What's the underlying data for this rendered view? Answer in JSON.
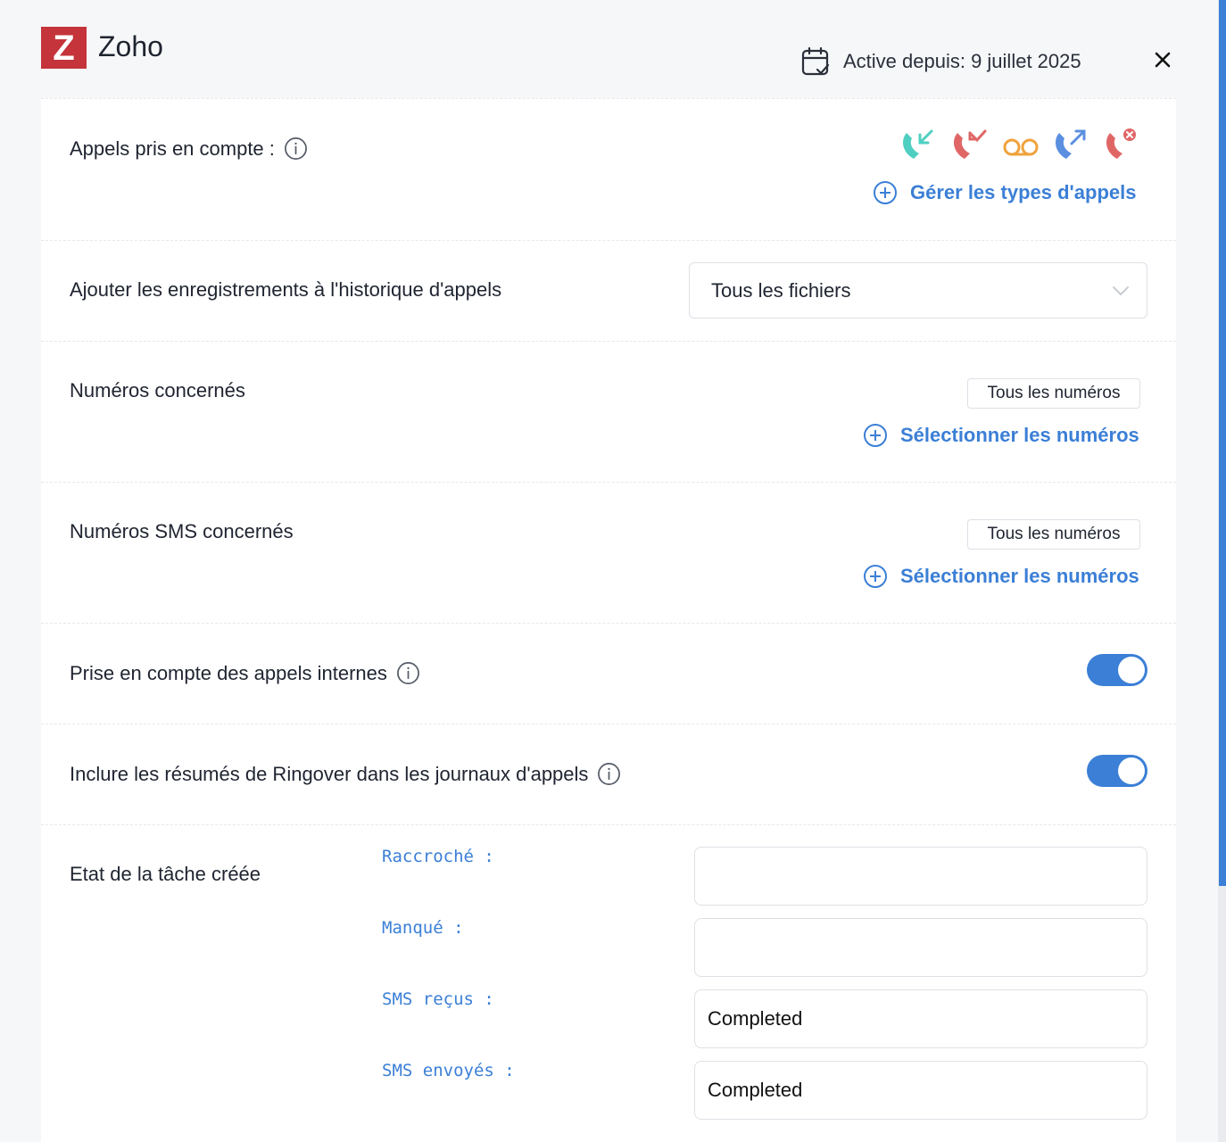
{
  "header": {
    "logo_letter": "Z",
    "app_name": "Zoho",
    "active_since": "Active depuis: 9 juillet 2025"
  },
  "colors": {
    "accent": "#3b7fd6",
    "brand": "#c4343a",
    "incoming": "#4fcfc1",
    "missed": "#e06666",
    "voicemail": "#f0a23c",
    "outgoing": "#5b8fe0",
    "rejected": "#e06666"
  },
  "sections": {
    "calls": {
      "label": "Appels pris en compte :",
      "call_type_icons": [
        "incoming-call-icon",
        "missed-call-icon",
        "voicemail-icon",
        "outgoing-call-icon",
        "rejected-call-icon"
      ],
      "manage_link": "Gérer les types d'appels"
    },
    "recordings": {
      "label": "Ajouter les enregistrements à l'historique d'appels",
      "selected": "Tous les fichiers"
    },
    "numbers": {
      "label": "Numéros concernés",
      "chip": "Tous les numéros",
      "select_link": "Sélectionner les numéros"
    },
    "sms_numbers": {
      "label": "Numéros SMS concernés",
      "chip": "Tous les numéros",
      "select_link": "Sélectionner les numéros"
    },
    "internal_calls": {
      "label": "Prise en compte des appels internes",
      "enabled": true
    },
    "summaries": {
      "label": "Inclure les résumés de Ringover dans les journaux d'appels",
      "enabled": true
    },
    "task_state": {
      "label": "Etat de la tâche créée",
      "fields": [
        {
          "label": "Raccroché :",
          "value": ""
        },
        {
          "label": "Manqué :",
          "value": ""
        },
        {
          "label": "SMS reçus :",
          "value": "Completed"
        },
        {
          "label": "SMS envoyés :",
          "value": "Completed"
        }
      ]
    }
  }
}
